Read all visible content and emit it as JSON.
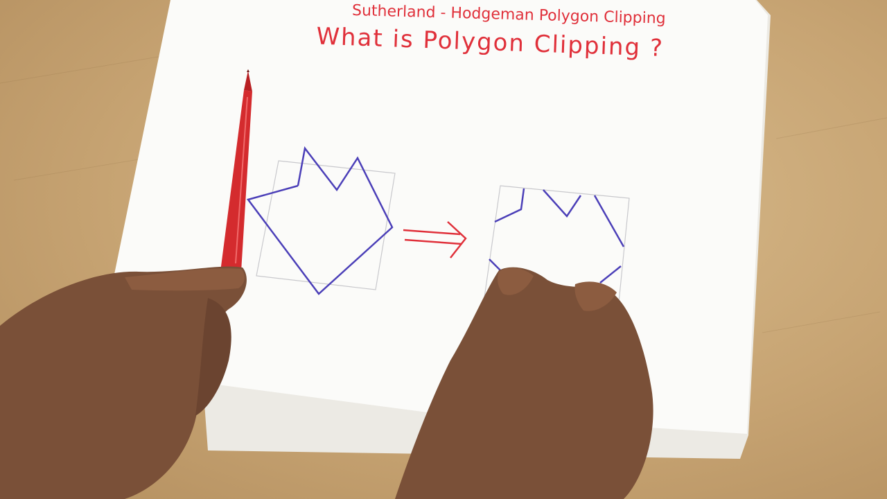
{
  "heading_top": "Sutherland - Hodgeman Polygon Clipping",
  "heading_main": "What is Polygon Clipping ?",
  "colors": {
    "ink_red": "#e0303a",
    "ink_blue": "#4b3fb8",
    "desk": "#c7a473",
    "paper": "#fbfbf9",
    "pen_red": "#d42b2e",
    "skin": "#7a5038"
  }
}
